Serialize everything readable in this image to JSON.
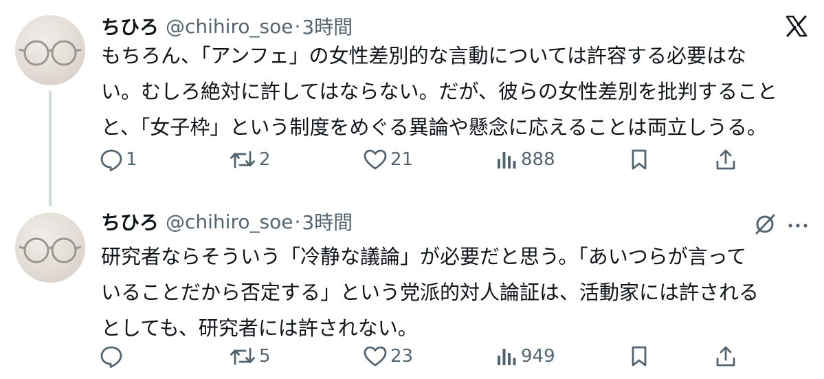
{
  "tweets": [
    {
      "name": "ちひろ",
      "handle": "@chihiro_soe",
      "dot": "·",
      "time": "3時間",
      "lines": [
        "もちろん、「アンフェ」の女性差別的な言動については許容する必要はな",
        "い。むしろ絶対に許してはならない。だが、彼らの女性差別を批判すること",
        "と、「女子枠」という制度をめぐる異論や懸念に応えることは両立しうる。"
      ],
      "replies": "1",
      "reposts": "2",
      "likes": "21",
      "views": "888"
    },
    {
      "name": "ちひろ",
      "handle": "@chihiro_soe",
      "dot": "·",
      "time": "3時間",
      "lines": [
        "研究者ならそういう「冷静な議論」が必要だと思う。「あいつらが言って",
        "いることだから否定する」という党派的対人論証は、活動家には許される",
        "としても、研究者には許されない。"
      ],
      "replies": "",
      "reposts": "5",
      "likes": "23",
      "views": "949"
    }
  ],
  "icons": {
    "reply": "reply-icon",
    "repost": "repost-icon",
    "like": "like-icon",
    "views": "views-icon",
    "bookmark": "bookmark-icon",
    "share": "share-icon",
    "brand": "x-logo-icon",
    "grok": "grok-icon",
    "more": "more-icon"
  },
  "colors": {
    "text": "#0f1419",
    "secondary": "#536471",
    "thread_line": "#cfd9de"
  }
}
